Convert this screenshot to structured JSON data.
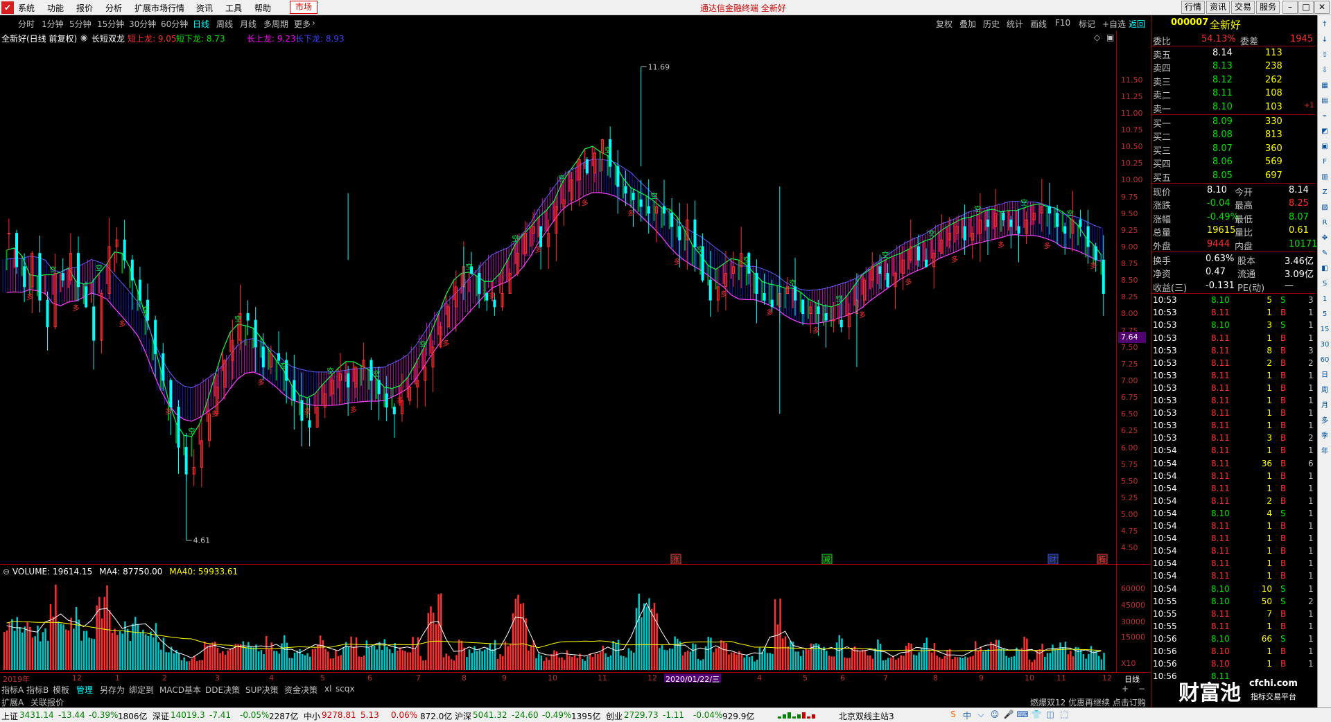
{
  "menu": {
    "items": [
      "系统",
      "功能",
      "报价",
      "分析",
      "扩展市场行情",
      "资讯",
      "工具",
      "帮助"
    ],
    "market_tab": "市场",
    "title": "通达信金融终端 全新好",
    "right_buttons": [
      "行情",
      "资讯",
      "交易",
      "服务"
    ]
  },
  "periods": {
    "items": [
      "分时",
      "1分钟",
      "5分钟",
      "15分钟",
      "30分钟",
      "60分钟",
      "日线",
      "周线",
      "月线",
      "多周期",
      "更多"
    ],
    "active": "日线"
  },
  "toolbar": {
    "items": [
      "复权",
      "叠加",
      "历史",
      "统计",
      "画线",
      "F10",
      "标记",
      "+自选",
      "返回"
    ]
  },
  "indicator_line": {
    "stock": "全新好(日线 前复权)",
    "indicator": "长短双龙",
    "items": [
      {
        "label": "短上龙: 9.05",
        "color": "#ff3030"
      },
      {
        "label": "短下龙: 8.73",
        "color": "#00e000"
      },
      {
        "label": "长上龙: 9.23",
        "color": "#ff00ff"
      },
      {
        "label": "长下龙: 8.93",
        "color": "#4040ff"
      }
    ]
  },
  "chart_data": {
    "type": "candlestick",
    "title": "全新好(日线 前复权)",
    "y_ticks": [
      "11.50",
      "11.25",
      "11.00",
      "10.75",
      "10.50",
      "10.25",
      "10.00",
      "9.75",
      "9.50",
      "9.25",
      "9.00",
      "8.75",
      "8.50",
      "8.25",
      "8.00",
      "7.75",
      "7.50",
      "7.25",
      "7.00",
      "6.75",
      "6.50",
      "6.25",
      "6.00",
      "5.75",
      "5.50",
      "5.25",
      "5.00",
      "4.75",
      "4.50"
    ],
    "ylim": [
      4.4,
      11.9
    ],
    "current_price_marker": "7.64",
    "annotations": [
      {
        "label": "11.69",
        "x_index": 82,
        "price": 11.69
      },
      {
        "label": "4.61",
        "x_index": 23,
        "price": 4.61
      }
    ],
    "event_markers": [
      "涨",
      "减",
      "财",
      "腾"
    ],
    "close_path": [
      9.2,
      8.7,
      8.4,
      8.9,
      8.2,
      7.8,
      8.6,
      8.5,
      8.9,
      8.4,
      8.1,
      7.6,
      8.3,
      9.0,
      9.1,
      8.8,
      8.5,
      8.2,
      7.9,
      7.4,
      7.0,
      6.6,
      6.0,
      5.6,
      5.7,
      6.1,
      6.5,
      6.9,
      7.3,
      7.6,
      8.0,
      7.9,
      7.5,
      7.2,
      7.4,
      7.3,
      7.0,
      6.7,
      6.4,
      6.3,
      6.6,
      6.8,
      7.0,
      7.1,
      6.9,
      7.2,
      7.3,
      7.0,
      6.8,
      6.6,
      6.5,
      6.7,
      6.9,
      7.0,
      7.2,
      7.5,
      7.8,
      8.1,
      8.4,
      8.7,
      8.6,
      8.3,
      8.2,
      8.1,
      8.3,
      8.6,
      8.9,
      9.2,
      9.3,
      9.0,
      9.2,
      9.6,
      9.7,
      10.0,
      10.3,
      10.1,
      10.4,
      10.6,
      10.2,
      9.9,
      9.8,
      9.7,
      9.6,
      9.5,
      9.6,
      9.5,
      9.3,
      9.1,
      9.4,
      9.0,
      8.5,
      8.2,
      8.4,
      8.6,
      8.7,
      8.9,
      8.6,
      8.3,
      8.2,
      8.1,
      8.3,
      8.4,
      8.2,
      8.0,
      8.1,
      8.0,
      7.9,
      7.9,
      7.8,
      8.0,
      8.2,
      8.5,
      8.7,
      8.6,
      8.4,
      8.6,
      8.8,
      9.0,
      8.8,
      8.7,
      8.9,
      9.1,
      9.2,
      9.3,
      9.1,
      9.2,
      9.4,
      9.3,
      9.5,
      9.4,
      9.3,
      9.2,
      9.4,
      9.5,
      9.6,
      9.5,
      9.3,
      9.2,
      9.4,
      9.3,
      9.0,
      8.8,
      8.3
    ],
    "volume": {
      "label": "VOLUME: 19614.15",
      "ma4": "MA4: 87750.00",
      "ma40": "MA40: 59933.61",
      "y_ticks": [
        "60000",
        "45000",
        "30000",
        "15000",
        "X10"
      ]
    },
    "x_labels": [
      "2019年",
      "12",
      "1",
      "2",
      "3",
      "4",
      "5",
      "6",
      "7",
      "8",
      "9",
      "10",
      "11",
      "12",
      "2020/01/22/三",
      "4",
      "5",
      "6",
      "7",
      "8",
      "9",
      "10",
      "11",
      "12"
    ],
    "period_label": "日线"
  },
  "bottom_tabs": {
    "items": [
      "指标A",
      "指标B",
      "模板",
      "管理",
      "另存为",
      "绑定到",
      "MACD基本",
      "DDE决策",
      "SUP决策",
      "资金决策",
      "xl",
      "scqx"
    ],
    "active": "管理"
  },
  "ext_bar": {
    "items": [
      "扩展A",
      "关联报价"
    ],
    "right_text": "燃爆双12 优惠再继续 点击订购",
    "pen_label": "笔",
    "right_labels": [
      "价",
      "细",
      "势",
      "联",
      "值",
      "主"
    ]
  },
  "status": {
    "items": [
      {
        "name": "上证",
        "val": "3431.14",
        "chg": "-13.44",
        "pct": "-0.39%",
        "amt": "1806亿"
      },
      {
        "name": "深证",
        "val": "14019.3",
        "chg": "-7.41",
        "pct": "-0.05%",
        "amt": "2287亿"
      },
      {
        "name": "中小",
        "val": "9278.81",
        "chg": "5.13",
        "pct": "0.06%",
        "amt": "872.0亿"
      },
      {
        "name": "沪深",
        "val": "5041.32",
        "chg": "-24.60",
        "pct": "-0.49%",
        "amt": "1395亿"
      },
      {
        "name": "创业",
        "val": "2729.73",
        "chg": "-1.11",
        "pct": "-0.04%",
        "amt": "929.9亿"
      }
    ],
    "server": "北京双线主站3"
  },
  "quote": {
    "code": "000007",
    "name": "全新好",
    "weibi_label": "委比",
    "weibi": "54.13%",
    "weicha_label": "委差",
    "weicha": "1945",
    "asks": [
      {
        "label": "卖五",
        "price": "8.14",
        "vol": "113",
        "flag": ""
      },
      {
        "label": "卖四",
        "price": "8.13",
        "vol": "238",
        "flag": ""
      },
      {
        "label": "卖三",
        "price": "8.12",
        "vol": "262",
        "flag": ""
      },
      {
        "label": "卖二",
        "price": "8.11",
        "vol": "108",
        "flag": ""
      },
      {
        "label": "卖一",
        "price": "8.10",
        "vol": "103",
        "flag": "+1"
      }
    ],
    "bids": [
      {
        "label": "买一",
        "price": "8.09",
        "vol": "330"
      },
      {
        "label": "买二",
        "price": "8.08",
        "vol": "813"
      },
      {
        "label": "买三",
        "price": "8.07",
        "vol": "360"
      },
      {
        "label": "买四",
        "price": "8.06",
        "vol": "569"
      },
      {
        "label": "买五",
        "price": "8.05",
        "vol": "697"
      }
    ],
    "stats": [
      {
        "l1": "现价",
        "v1": "8.10",
        "l2": "今开",
        "v2": "8.14"
      },
      {
        "l1": "涨跌",
        "v1": "-0.04",
        "l2": "最高",
        "v2": "8.25"
      },
      {
        "l1": "涨幅",
        "v1": "-0.49%",
        "l2": "最低",
        "v2": "8.07"
      },
      {
        "l1": "总量",
        "v1": "19615",
        "l2": "量比",
        "v2": "0.61"
      },
      {
        "l1": "外盘",
        "v1": "9444",
        "l2": "内盘",
        "v2": "10171"
      }
    ],
    "fin": [
      {
        "l1": "换手",
        "v1": "0.63%",
        "l2": "股本",
        "v2": "3.46亿"
      },
      {
        "l1": "净资",
        "v1": "0.47",
        "l2": "流通",
        "v2": "3.09亿"
      },
      {
        "l1": "收益(三)",
        "v1": "-0.131",
        "l2": "PE(动)",
        "v2": "—"
      }
    ],
    "ticks": [
      [
        "10:53",
        "8.10",
        "5",
        "S",
        "3"
      ],
      [
        "10:53",
        "8.11",
        "1",
        "B",
        "1"
      ],
      [
        "10:53",
        "8.10",
        "3",
        "S",
        "1"
      ],
      [
        "10:53",
        "8.11",
        "1",
        "B",
        "1"
      ],
      [
        "10:53",
        "8.11",
        "8",
        "B",
        "3"
      ],
      [
        "10:53",
        "8.11",
        "2",
        "B",
        "2"
      ],
      [
        "10:53",
        "8.11",
        "1",
        "B",
        "1"
      ],
      [
        "10:53",
        "8.11",
        "1",
        "B",
        "1"
      ],
      [
        "10:53",
        "8.11",
        "1",
        "B",
        "1"
      ],
      [
        "10:53",
        "8.11",
        "1",
        "B",
        "1"
      ],
      [
        "10:53",
        "8.11",
        "1",
        "B",
        "1"
      ],
      [
        "10:53",
        "8.11",
        "3",
        "B",
        "2"
      ],
      [
        "10:54",
        "8.11",
        "1",
        "B",
        "1"
      ],
      [
        "10:54",
        "8.11",
        "36",
        "B",
        "6"
      ],
      [
        "10:54",
        "8.11",
        "1",
        "B",
        "1"
      ],
      [
        "10:54",
        "8.11",
        "1",
        "B",
        "1"
      ],
      [
        "10:54",
        "8.11",
        "2",
        "B",
        "1"
      ],
      [
        "10:54",
        "8.10",
        "4",
        "S",
        "1"
      ],
      [
        "10:54",
        "8.11",
        "1",
        "B",
        "1"
      ],
      [
        "10:54",
        "8.11",
        "1",
        "B",
        "1"
      ],
      [
        "10:54",
        "8.11",
        "1",
        "B",
        "1"
      ],
      [
        "10:54",
        "8.11",
        "1",
        "B",
        "1"
      ],
      [
        "10:54",
        "8.11",
        "1",
        "B",
        "1"
      ],
      [
        "10:54",
        "8.10",
        "10",
        "S",
        "1"
      ],
      [
        "10:55",
        "8.10",
        "50",
        "S",
        "2"
      ],
      [
        "10:55",
        "8.11",
        "7",
        "B",
        "1"
      ],
      [
        "10:55",
        "8.11",
        "1",
        "B",
        "1"
      ],
      [
        "10:56",
        "8.10",
        "66",
        "S",
        "1"
      ],
      [
        "10:56",
        "8.10",
        "1",
        "B",
        "1"
      ],
      [
        "10:56",
        "8.10",
        "1",
        "B",
        "1"
      ],
      [
        "10:56",
        "8.11",
        "",
        "",
        " "
      ]
    ]
  },
  "watermark": {
    "brand": "财富池",
    "site": "cfchi.com",
    "sub": "指标交易平台"
  }
}
